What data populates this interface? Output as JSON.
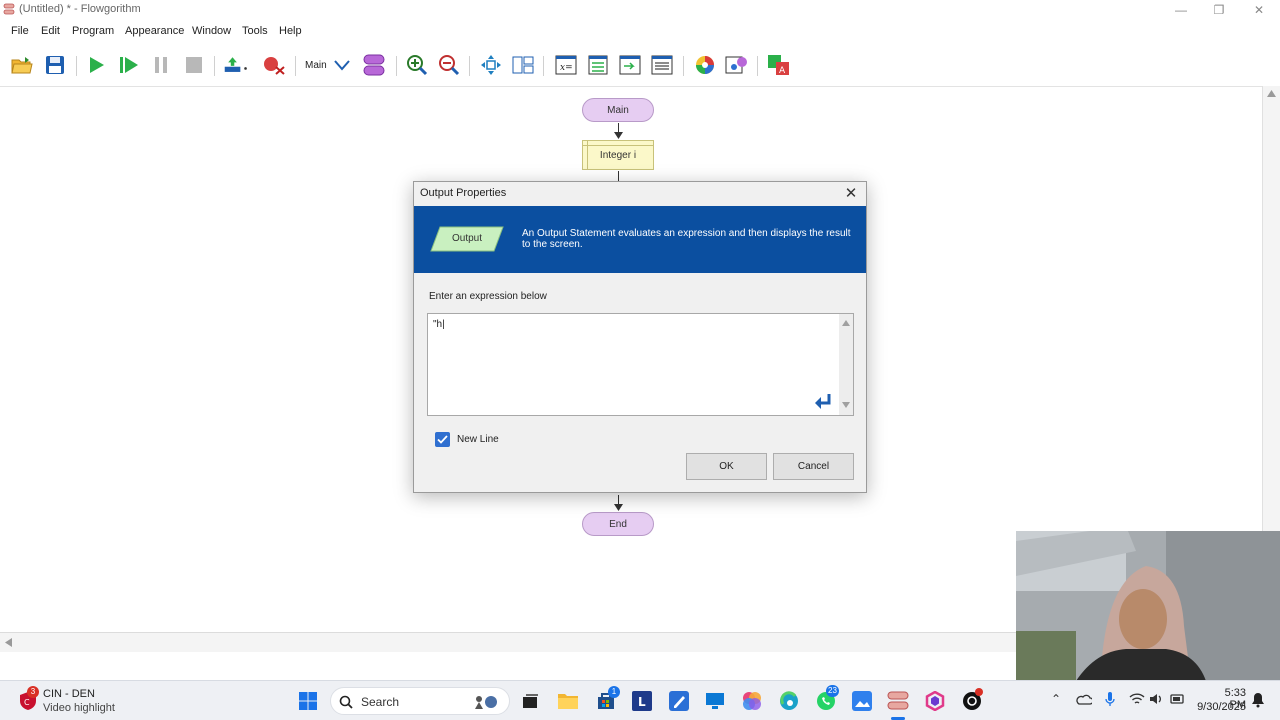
{
  "window": {
    "title": "(Untitled) * - Flowgorithm",
    "minimize_glyph": "—",
    "restore_glyph": "❐",
    "close_glyph": "✕"
  },
  "menu": {
    "items": [
      "File",
      "Edit",
      "Program",
      "Appearance",
      "Window",
      "Tools",
      "Help"
    ]
  },
  "toolbar": {
    "function_selector": "Main",
    "icons": [
      "open-icon",
      "save-icon",
      "run-icon",
      "step-run-icon",
      "pause-icon",
      "stop-icon",
      "step-icon",
      "breakpoint-icon",
      "function-dropdown-icon",
      "manage-functions-icon",
      "zoom-in-icon",
      "zoom-out-icon",
      "center-icon",
      "layout-icon",
      "variable-watch-icon",
      "console-icon",
      "output-window-icon",
      "source-view-icon",
      "color-scheme-icon",
      "settings-icon",
      "translate-icon"
    ]
  },
  "flowchart": {
    "start_label": "Main",
    "declare_label": "Integer i",
    "end_label": "End"
  },
  "dialog": {
    "title": "Output Properties",
    "banner_shape_label": "Output",
    "banner_text": "An Output Statement evaluates an expression and then displays the result to the screen.",
    "expression_label": "Enter an expression below",
    "expression_value": "\"h|",
    "newline_label": "New Line",
    "newline_checked": true,
    "ok_label": "OK",
    "cancel_label": "Cancel",
    "colors": {
      "banner": "#0b4fa0",
      "output_shape": "#c9f0c0"
    }
  },
  "taskbar": {
    "weather_badge": "3",
    "weather_title": "CIN - DEN",
    "weather_sub": "Video highlight",
    "search_label": "Search",
    "store_badge": "1",
    "whatsapp_badge": "23",
    "time": "5:33 PM",
    "date": "9/30/2025"
  }
}
